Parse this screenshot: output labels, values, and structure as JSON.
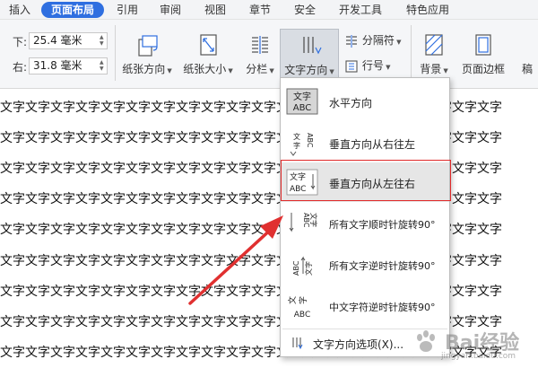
{
  "tabs": [
    {
      "label": "插入",
      "active": false
    },
    {
      "label": "页面布局",
      "active": true
    },
    {
      "label": "引用",
      "active": false
    },
    {
      "label": "审阅",
      "active": false
    },
    {
      "label": "视图",
      "active": false
    },
    {
      "label": "章节",
      "active": false
    },
    {
      "label": "安全",
      "active": false
    },
    {
      "label": "开发工具",
      "active": false
    },
    {
      "label": "特色应用",
      "active": false
    }
  ],
  "margins": {
    "bottom_label": "下:",
    "bottom_value": "25.4 毫米",
    "right_label": "右:",
    "right_value": "31.8 毫米"
  },
  "ribbon": {
    "orientation": "纸张方向",
    "size": "纸张大小",
    "columns": "分栏",
    "text_direction": "文字方向",
    "column_break": "分隔符",
    "line_number": "行号",
    "background": "背景",
    "page_border": "页面边框",
    "partial": "稿"
  },
  "document": {
    "line_text": "文字文字文字文字文字文字文字文字文字文字文字文字文字文字文字文字文字文字文字文字"
  },
  "menu": {
    "items": [
      {
        "label": "水平方向",
        "icon": "horizontal-text-icon"
      },
      {
        "label": "垂直方向从右往左",
        "icon": "vertical-rtl-icon"
      },
      {
        "label": "垂直方向从左往右",
        "icon": "vertical-ltr-icon"
      },
      {
        "label": "所有文字顺时针旋转90°",
        "icon": "rotate-cw-icon"
      },
      {
        "label": "所有文字逆时针旋转90°",
        "icon": "rotate-ccw-icon"
      },
      {
        "label": "中文字符逆时针旋转90°",
        "icon": "cjk-rotate-ccw-icon"
      }
    ],
    "options_label": "文字方向选项(X)...",
    "icon_text_top": "文字",
    "icon_text_bottom": "ABC"
  },
  "watermark": {
    "text": "Bai经验",
    "sub": "jingyan.baidu.com"
  },
  "colors": {
    "accent": "#2f6fe0",
    "highlight": "#e02a2a"
  }
}
